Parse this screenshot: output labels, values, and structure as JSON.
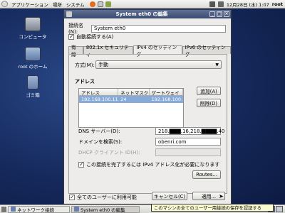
{
  "top_panel": {
    "menus": [
      "アプリケーション",
      "場所",
      "システム"
    ],
    "datetime": "12月28日 (水) 1:07",
    "user": "root"
  },
  "desktop_icons": [
    {
      "label": "コンピュータ",
      "icon": "computer-icon"
    },
    {
      "label": "root のホーム",
      "icon": "home-folder-icon"
    },
    {
      "label": "ゴミ箱",
      "icon": "trash-icon"
    }
  ],
  "window": {
    "title": "System eth0 の編集",
    "connection_name_label": "接続名(N):",
    "connection_name_value": "System eth0",
    "auto_connect_label": "自動接続する(A)",
    "tabs": [
      "有線",
      "802.1x セキュリティ",
      "IPv4 のセッティング",
      "IPv6 のセッティング"
    ],
    "method_label": "方式(M):",
    "method_value": "手動",
    "address_heading": "アドレス",
    "address_columns": [
      "アドレス",
      "ネットマスク",
      "ゲートウェイ"
    ],
    "address_rows": [
      {
        "address": "192.168.100.11",
        "netmask": "24",
        "gateway": "192.168.100.1"
      }
    ],
    "add_button": "追加(A)",
    "delete_button": "削除(D)",
    "dns_label": "DNS サーバー(D):",
    "dns_value": "218.▇▇▇.16,218.▇▇▇▇.40",
    "search_domain_label": "ドメインを検索(S):",
    "search_domain_value": "obenri.com",
    "dhcp_client_label": "DHCP クライアント ID(H):",
    "require_ipv4_label": "この接続を完了するには IPv4 アドレス化が必要になります",
    "routes_button": "Routes...",
    "all_users_label": "全てのユーザーに利用可能",
    "cancel_button": "キャンセル(C)",
    "apply_button": "適用..."
  },
  "taskbar": {
    "items": [
      "ネットワーク接続",
      "System eth0 の編集"
    ]
  },
  "tooltip": "このマシンの全てのユーザー用接続の保存を認証する",
  "colors": {
    "titlebar": "#4a5a80",
    "selection": "#86abd9",
    "desktop": "#1a2c5e"
  }
}
